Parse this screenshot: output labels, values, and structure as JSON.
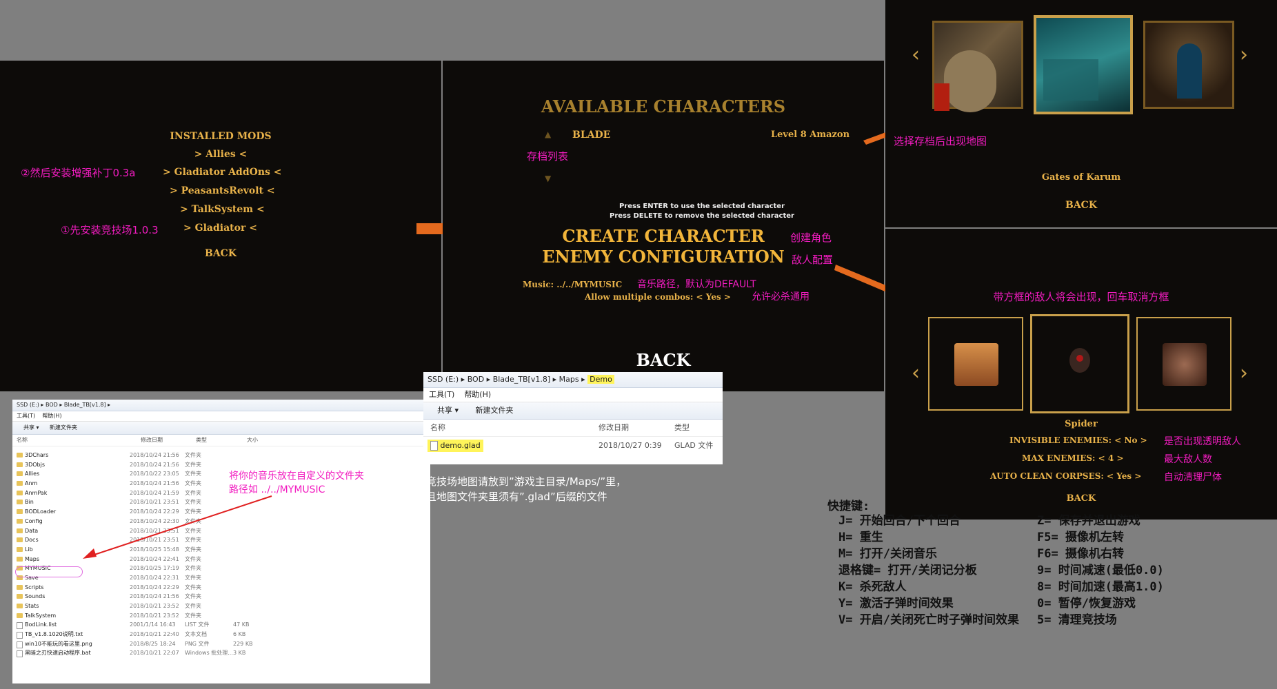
{
  "mods_panel": {
    "title": "INSTALLED MODS",
    "items": [
      "Allies",
      "Gladiator AddOns",
      "PeasantsRevolt",
      "TalkSystem",
      "Gladiator"
    ],
    "back": "BACK",
    "note_addons": "②然后安装增强补丁0.3a",
    "note_gladiator": "①先安装竞技场1.0.3"
  },
  "chars_panel": {
    "title": "AVAILABLE CHARACTERS",
    "char_name": "BLADE",
    "char_level": "Level 8 Amazon",
    "save_list_note": "存档列表",
    "hint_line1": "Press ENTER to use the selected character",
    "hint_line2": "Press DELETE to remove the selected character",
    "create_label": "CREATE CHARACTER",
    "enemy_label": "ENEMY CONFIGURATION",
    "create_note": "创建角色",
    "enemy_note": "敌人配置",
    "music_label": "Music: ../../MYMUSIC",
    "music_note": "音乐路径，默认为DEFAULT",
    "combos_label": "Allow multiple combos:",
    "combos_value": "Yes",
    "combos_note": "允许必杀通用",
    "back": "BACK"
  },
  "maps_panel": {
    "note": "选择存档后出现地图",
    "map_name": "Gates of Karum",
    "back": "BACK"
  },
  "enemy_panel": {
    "note": "带方框的敌人将会出现，回车取消方框",
    "enemy_name": "Spider",
    "invisible_label": "INVISIBLE ENEMIES:",
    "invisible_value": "No",
    "invisible_note": "是否出现透明敌人",
    "max_label": "MAX ENEMIES:",
    "max_value": "4",
    "max_note": "最大敌人数",
    "auto_label": "AUTO CLEAN CORPSES:",
    "auto_value": "Yes",
    "auto_note": "自动清理尸体",
    "back": "BACK"
  },
  "explorer1": {
    "breadcrumb": [
      "SSD (E:)",
      "BOD",
      "Blade_TB[v1.8]"
    ],
    "menu": [
      "工具(T)",
      "帮助(H)"
    ],
    "toolbar": [
      "共享 ▾",
      "新建文件夹"
    ],
    "columns": [
      "名称",
      "修改日期",
      "类型",
      "大小"
    ],
    "rows": [
      {
        "name": "3DChars",
        "date": "2018/10/24 21:56",
        "type": "文件夹",
        "size": ""
      },
      {
        "name": "3DObjs",
        "date": "2018/10/24 21:56",
        "type": "文件夹",
        "size": ""
      },
      {
        "name": "Allies",
        "date": "2018/10/22 23:05",
        "type": "文件夹",
        "size": ""
      },
      {
        "name": "Anm",
        "date": "2018/10/24 21:56",
        "type": "文件夹",
        "size": ""
      },
      {
        "name": "AnmPak",
        "date": "2018/10/24 21:59",
        "type": "文件夹",
        "size": ""
      },
      {
        "name": "Bin",
        "date": "2018/10/21 23:51",
        "type": "文件夹",
        "size": ""
      },
      {
        "name": "BODLoader",
        "date": "2018/10/24 22:29",
        "type": "文件夹",
        "size": ""
      },
      {
        "name": "Config",
        "date": "2018/10/24 22:30",
        "type": "文件夹",
        "size": ""
      },
      {
        "name": "Data",
        "date": "2018/10/21 23:51",
        "type": "文件夹",
        "size": ""
      },
      {
        "name": "Docs",
        "date": "2018/10/21 23:51",
        "type": "文件夹",
        "size": ""
      },
      {
        "name": "Lib",
        "date": "2018/10/25 15:48",
        "type": "文件夹",
        "size": ""
      },
      {
        "name": "Maps",
        "date": "2018/10/24 22:41",
        "type": "文件夹",
        "size": ""
      },
      {
        "name": "MYMUSIC",
        "date": "2018/10/25 17:19",
        "type": "文件夹",
        "size": ""
      },
      {
        "name": "Save",
        "date": "2018/10/24 22:31",
        "type": "文件夹",
        "size": ""
      },
      {
        "name": "Scripts",
        "date": "2018/10/24 22:29",
        "type": "文件夹",
        "size": ""
      },
      {
        "name": "Sounds",
        "date": "2018/10/24 21:56",
        "type": "文件夹",
        "size": ""
      },
      {
        "name": "Stats",
        "date": "2018/10/21 23:52",
        "type": "文件夹",
        "size": ""
      },
      {
        "name": "TalkSystem",
        "date": "2018/10/21 23:52",
        "type": "文件夹",
        "size": ""
      },
      {
        "name": "BodLink.list",
        "date": "2001/1/14 16:43",
        "type": "LIST 文件",
        "size": "47 KB"
      },
      {
        "name": "TB_v1.8.1020说明.txt",
        "date": "2018/10/21 22:40",
        "type": "文本文档",
        "size": "6 KB"
      },
      {
        "name": "win10不能玩的看这里.png",
        "date": "2018/8/25 18:24",
        "type": "PNG 文件",
        "size": "229 KB"
      },
      {
        "name": "黑暗之刃快速启动程序.bat",
        "date": "2018/10/21 22:07",
        "type": "Windows 批处理...",
        "size": "3 KB"
      }
    ],
    "note_line1": "将你的音乐放在自定义的文件夹",
    "note_line2": "路径如 ../../MYMUSIC"
  },
  "explorer2": {
    "breadcrumb": [
      "SSD (E:)",
      "BOD",
      "Blade_TB[v1.8]",
      "Maps",
      "Demo"
    ],
    "menu": [
      "工具(T)",
      "帮助(H)"
    ],
    "toolbar": [
      "共享 ▾",
      "新建文件夹"
    ],
    "columns": [
      "名称",
      "修改日期",
      "类型"
    ],
    "file_name": "demo.glad",
    "file_date": "2018/10/27 0:39",
    "file_type": "GLAD 文件",
    "note_line1": "竞技场地图请放到”游戏主目录/Maps/”里，",
    "note_line2": "且地图文件夹里须有”.glad”后缀的文件"
  },
  "shortcuts": {
    "title": "快捷键:",
    "left": [
      "J= 开始回合/下个回合",
      "H= 重生",
      "M= 打开/关闭音乐",
      "退格键= 打开/关闭记分板",
      "K= 杀死敌人",
      "Y= 激活子弹时间效果",
      "V= 开启/关闭死亡时子弹时间效果"
    ],
    "right": [
      "Z= 保存并退出游戏",
      "F5= 摄像机左转",
      "F6= 摄像机右转",
      "9= 时间减速(最低0.0)",
      "8= 时间加速(最高1.0)",
      "0= 暂停/恢复游戏",
      "5= 清理竞技场"
    ]
  },
  "colors": {
    "gold": "#e8b24a",
    "annotation": "#f21cc0",
    "arrow": "#e46a1e",
    "panel": "#0d0b09"
  }
}
